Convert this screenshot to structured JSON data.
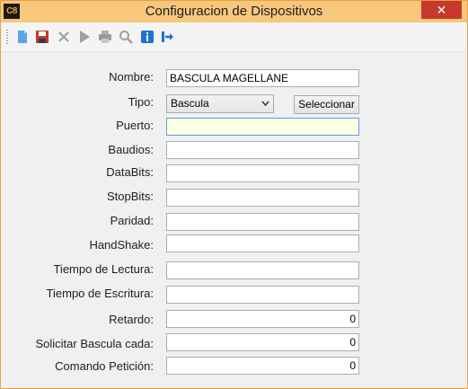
{
  "window": {
    "title": "Configuracion de Dispositivos",
    "app_logo": "C8",
    "close_label": "✕",
    "accent_color": "#f5a623"
  },
  "toolbar": {
    "buttons": [
      {
        "name": "new-document-icon",
        "enabled": true
      },
      {
        "name": "save-icon",
        "enabled": true
      },
      {
        "name": "delete-icon",
        "enabled": false
      },
      {
        "name": "run-icon",
        "enabled": false
      },
      {
        "name": "print-icon",
        "enabled": false
      },
      {
        "name": "search-icon",
        "enabled": false
      },
      {
        "name": "info-icon",
        "enabled": true
      },
      {
        "name": "exit-icon",
        "enabled": true
      }
    ]
  },
  "form": {
    "nombre": {
      "label": "Nombre:",
      "value": "BASCULA MAGELLANE"
    },
    "tipo": {
      "label": "Tipo:",
      "value": "Bascula",
      "button_label": "Seleccionar"
    },
    "puerto": {
      "label": "Puerto:",
      "value": ""
    },
    "baudios": {
      "label": "Baudios:",
      "value": ""
    },
    "databits": {
      "label": "DataBits:",
      "value": ""
    },
    "stopbits": {
      "label": "StopBits:",
      "value": ""
    },
    "paridad": {
      "label": "Paridad:",
      "value": ""
    },
    "handshake": {
      "label": "HandShake:",
      "value": ""
    },
    "tiempo_lectura": {
      "label": "Tiempo de Lectura:",
      "value": ""
    },
    "tiempo_escritura": {
      "label": "Tiempo de Escritura:",
      "value": ""
    },
    "retardo": {
      "label": "Retardo:",
      "value": "0"
    },
    "solicitar": {
      "label": "Solicitar Bascula cada:",
      "value": "0"
    },
    "comando": {
      "label": "Comando Petición:",
      "value": "0"
    }
  }
}
